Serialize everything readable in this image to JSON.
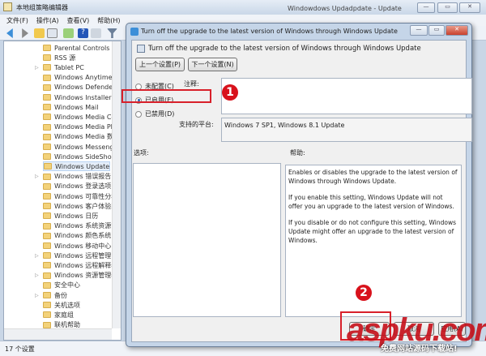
{
  "main_window": {
    "title": "本地组策略编辑器",
    "bg_title": "Windowdows Updadpdate  - Update",
    "menu": [
      "文件(F)",
      "操作(A)",
      "查看(V)",
      "帮助(H)"
    ],
    "tree_items": [
      {
        "label": "Parental Controls",
        "expandable": false
      },
      {
        "label": "RSS 源",
        "expandable": false
      },
      {
        "label": "Tablet PC",
        "expandable": true
      },
      {
        "label": "Windows Anytime U",
        "expandable": false
      },
      {
        "label": "Windows Defender",
        "expandable": false
      },
      {
        "label": "Windows Installer",
        "expandable": false
      },
      {
        "label": "Windows Mail",
        "expandable": false
      },
      {
        "label": "Windows Media Ce",
        "expandable": false
      },
      {
        "label": "Windows Media Pla",
        "expandable": false
      },
      {
        "label": "Windows Media 数",
        "expandable": false
      },
      {
        "label": "Windows Messenge",
        "expandable": false
      },
      {
        "label": "Windows SideShow",
        "expandable": false
      },
      {
        "label": "Windows Update",
        "expandable": false,
        "selected": true
      },
      {
        "label": "Windows 错误报告",
        "expandable": true
      },
      {
        "label": "Windows 登录选项",
        "expandable": false
      },
      {
        "label": "Windows 可靠性分析",
        "expandable": false
      },
      {
        "label": "Windows 客户体验改",
        "expandable": false
      },
      {
        "label": "Windows 日历",
        "expandable": false
      },
      {
        "label": "Windows 系统资源管",
        "expandable": false
      },
      {
        "label": "Windows 颜色系统",
        "expandable": false
      },
      {
        "label": "Windows 移动中心",
        "expandable": false
      },
      {
        "label": "Windows 远程管理 (",
        "expandable": true
      },
      {
        "label": "Windows 远程解释器",
        "expandable": false
      },
      {
        "label": "Windows 资源管理器",
        "expandable": true
      },
      {
        "label": "安全中心",
        "expandable": false
      },
      {
        "label": "备份",
        "expandable": true
      },
      {
        "label": "关机选项",
        "expandable": false
      },
      {
        "label": "家庭组",
        "expandable": false
      },
      {
        "label": "联机帮助",
        "expandable": false
      }
    ],
    "status": "17 个设置"
  },
  "dialog": {
    "title": "Turn off the upgrade to the latest version of Windows through Windows Update",
    "header": "Turn off the upgrade to the latest version of Windows through Windows Update",
    "prev_button": "上一个设置(P)",
    "next_button": "下一个设置(N)",
    "radios": [
      {
        "label": "未配置(C)",
        "checked": false
      },
      {
        "label": "已启用(E)",
        "checked": true
      },
      {
        "label": "已禁用(D)",
        "checked": false
      }
    ],
    "comment_label": "注释:",
    "comment_value": "",
    "platform_label": "支持的平台:",
    "platform_value": "Windows 7 SP1, Windows 8.1 Update",
    "options_label": "选项:",
    "help_label": "帮助:",
    "help_paragraphs": [
      "Enables or disables the upgrade to the latest version of Windows through Windows Update.",
      "If you enable this setting, Windows Update will not offer you an upgrade to the latest version of Windows.",
      "If you disable or do not configure this setting, Windows Update might offer an upgrade to the latest version of Windows."
    ],
    "ok_button": "确定",
    "cancel_button": "取消",
    "apply_button": "应用(A)"
  },
  "annotations": {
    "step1": "1",
    "step2": "2"
  },
  "watermark": {
    "text": "aspku.com",
    "subtext": "免费网站源码下载站!"
  },
  "colors": {
    "annotation_red": "#d8121c"
  }
}
